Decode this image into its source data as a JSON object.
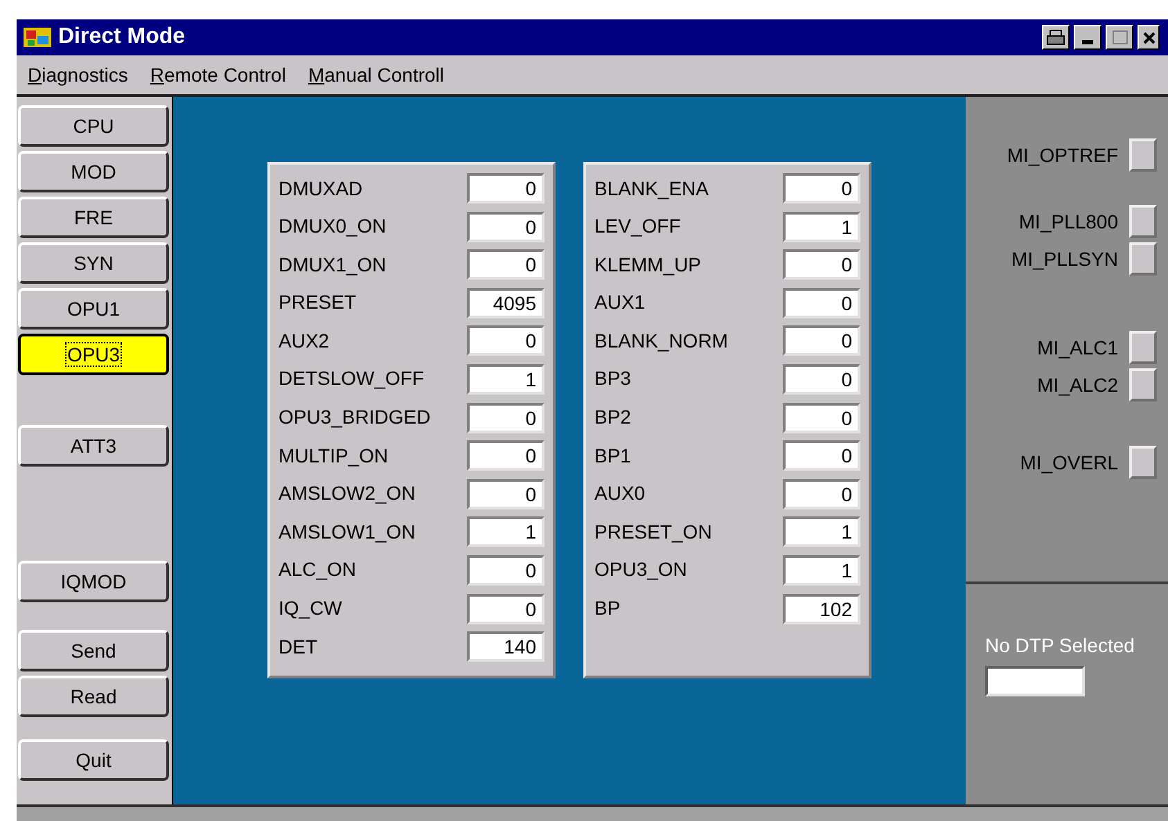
{
  "window": {
    "title": "Direct Mode"
  },
  "menu": [
    "Diagnostics",
    "Remote Control",
    "Manual Controll"
  ],
  "sidebar": {
    "groups": [
      {
        "buttons": [
          {
            "label": "CPU",
            "selected": false
          },
          {
            "label": "MOD",
            "selected": false
          },
          {
            "label": "FRE",
            "selected": false
          },
          {
            "label": "SYN",
            "selected": false
          },
          {
            "label": "OPU1",
            "selected": false
          },
          {
            "label": "OPU3",
            "selected": true
          }
        ]
      },
      {
        "buttons": [
          {
            "label": "ATT3",
            "selected": false
          }
        ]
      },
      {
        "buttons": [
          {
            "label": "IQMOD",
            "selected": false
          }
        ]
      },
      {
        "buttons": [
          {
            "label": "Send",
            "selected": false
          },
          {
            "label": "Read",
            "selected": false
          }
        ]
      },
      {
        "buttons": [
          {
            "label": "Quit",
            "selected": false
          }
        ]
      }
    ]
  },
  "panels": [
    {
      "fields": [
        {
          "label": "DMUXAD",
          "value": "0"
        },
        {
          "label": "DMUX0_ON",
          "value": "0"
        },
        {
          "label": "DMUX1_ON",
          "value": "0"
        },
        {
          "label": "PRESET",
          "value": "4095"
        },
        {
          "label": "AUX2",
          "value": "0"
        },
        {
          "label": "DETSLOW_OFF",
          "value": "1"
        },
        {
          "label": "OPU3_BRIDGED",
          "value": "0"
        },
        {
          "label": "MULTIP_ON",
          "value": "0"
        },
        {
          "label": "AMSLOW2_ON",
          "value": "0"
        },
        {
          "label": "AMSLOW1_ON",
          "value": "1"
        },
        {
          "label": "ALC_ON",
          "value": "0"
        },
        {
          "label": "IQ_CW",
          "value": "0"
        },
        {
          "label": "DET",
          "value": "140"
        }
      ]
    },
    {
      "fields": [
        {
          "label": "BLANK_ENA",
          "value": "0"
        },
        {
          "label": "LEV_OFF",
          "value": "1"
        },
        {
          "label": "KLEMM_UP",
          "value": "0"
        },
        {
          "label": "AUX1",
          "value": "0"
        },
        {
          "label": "BLANK_NORM",
          "value": "0"
        },
        {
          "label": "BP3",
          "value": "0"
        },
        {
          "label": "BP2",
          "value": "0"
        },
        {
          "label": "BP1",
          "value": "0"
        },
        {
          "label": "AUX0",
          "value": "0"
        },
        {
          "label": "PRESET_ON",
          "value": "1"
        },
        {
          "label": "OPU3_ON",
          "value": "1"
        },
        {
          "label": "BP",
          "value": "102"
        }
      ]
    }
  ],
  "indicator_groups": [
    [
      {
        "label": "MI_OPTREF",
        "lit": false
      }
    ],
    [
      {
        "label": "MI_PLL800",
        "lit": false
      },
      {
        "label": "MI_PLLSYN",
        "lit": false
      }
    ],
    [
      {
        "label": "MI_ALC1",
        "lit": false
      },
      {
        "label": "MI_ALC2",
        "lit": false
      }
    ],
    [
      {
        "label": "MI_OVERL",
        "lit": false
      }
    ]
  ],
  "dtp": {
    "label": "No DTP Selected"
  }
}
